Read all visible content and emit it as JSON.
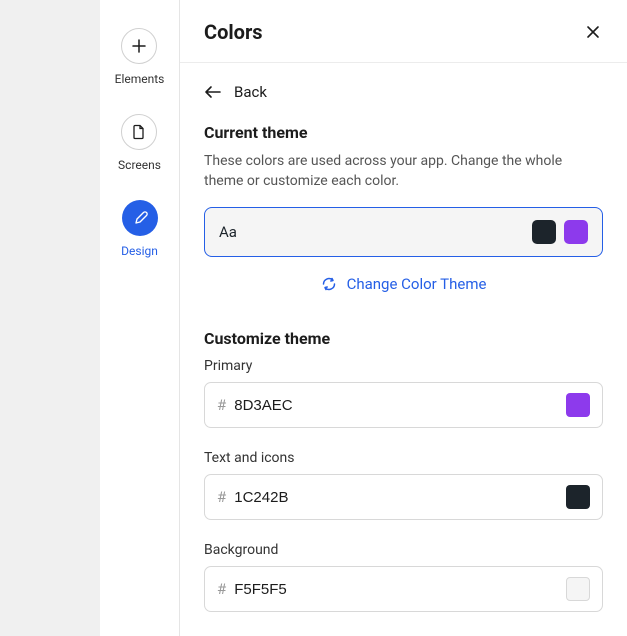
{
  "sidebar": {
    "items": [
      {
        "label": "Elements"
      },
      {
        "label": "Screens"
      },
      {
        "label": "Design"
      }
    ]
  },
  "panel": {
    "title": "Colors",
    "back_label": "Back"
  },
  "current_theme": {
    "heading": "Current theme",
    "description": "These colors are used across your app. Change the whole theme or customize each color.",
    "preview_text": "Aa",
    "swatch_text_color": "#1C242B",
    "swatch_primary_color": "#8D3AEC",
    "change_label": "Change Color Theme"
  },
  "customize": {
    "heading": "Customize theme",
    "fields": [
      {
        "label": "Primary",
        "value": "8D3AEC",
        "color": "#8D3AEC"
      },
      {
        "label": "Text and icons",
        "value": "1C242B",
        "color": "#1C242B"
      },
      {
        "label": "Background",
        "value": "F5F5F5",
        "color": "#F5F5F5"
      }
    ]
  }
}
